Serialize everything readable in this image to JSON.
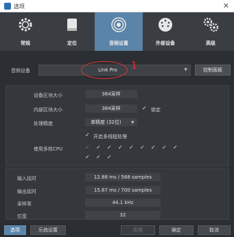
{
  "window": {
    "title": "选项",
    "close_glyph": "✕"
  },
  "toolbar": {
    "items": [
      {
        "label": "常规",
        "icon": "gear-icon"
      },
      {
        "label": "定位",
        "icon": "drive-icon"
      },
      {
        "label": "音频设置",
        "icon": "speaker-icon",
        "selected": true
      },
      {
        "label": "外部设备",
        "icon": "midi-connector-icon"
      },
      {
        "label": "高级",
        "icon": "gears-icon"
      }
    ]
  },
  "audio_device": {
    "label": "音频设备",
    "value": "Link Pro",
    "control_panel_label": "控制面板",
    "annotation_number": "1"
  },
  "buffer_settings": {
    "device_block_size_label": "设备区块大小",
    "device_block_size_value": "384采样",
    "internal_block_size_label": "内部区块大小",
    "internal_block_size_value": "384采样",
    "lock_label": "锁定",
    "lock_checked": true,
    "precision_label": "处理精度",
    "precision_value": "单精度 (32位)",
    "multithread_label": "开启多线程处理",
    "multithread_checked": true,
    "cpu_label": "使用多核CPU",
    "cpu_checks_row1": [
      "✓",
      "✓",
      "✓",
      "✓",
      "✓",
      "✓",
      "✓",
      "✓",
      "✓"
    ],
    "cpu_checks_row2": [
      "✓",
      "✓",
      "✓"
    ],
    "cpu_first_dim": true
  },
  "latency": {
    "input_label": "输入延时",
    "input_value": "12.88 ms / 568 samples",
    "output_label": "输出延时",
    "output_value": "15.87 ms / 700 samples",
    "samplerate_label": "采样率",
    "samplerate_value": "44.1 kHz",
    "bitdepth_label": "位宽",
    "bitdepth_value": "32"
  },
  "footer": {
    "options_label": "选项",
    "song_settings_label": "乐曲设置",
    "apply_label": "应用",
    "ok_label": "确定",
    "cancel_label": "取消"
  },
  "colors": {
    "selected_tab": "#5a84a8",
    "annotation": "#e43333",
    "background": "#2b2e32"
  }
}
